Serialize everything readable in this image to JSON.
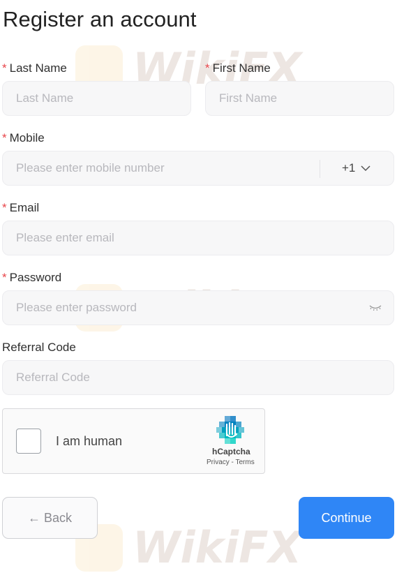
{
  "title": "Register an account",
  "required_mark": "*",
  "last_name": {
    "label": "Last Name",
    "placeholder": "Last Name"
  },
  "first_name": {
    "label": "First Name",
    "placeholder": "First Name"
  },
  "mobile": {
    "label": "Mobile",
    "placeholder": "Please enter mobile number",
    "country_code": "+1"
  },
  "email": {
    "label": "Email",
    "placeholder": "Please enter email"
  },
  "password": {
    "label": "Password",
    "placeholder": "Please enter password"
  },
  "referral": {
    "label": "Referral Code",
    "placeholder": "Referral Code"
  },
  "captcha": {
    "text": "I am human",
    "brand": "hCaptcha",
    "links": "Privacy - Terms"
  },
  "buttons": {
    "back": "← Back",
    "continue": "Continue"
  },
  "watermark": "WikiFX",
  "colors": {
    "accent": "#2f86f6",
    "required": "#e8454a",
    "field_bg": "#f7f7f8"
  },
  "icons": [
    "chevron-down-icon",
    "eye-closed-icon",
    "hcaptcha-logo-icon"
  ]
}
